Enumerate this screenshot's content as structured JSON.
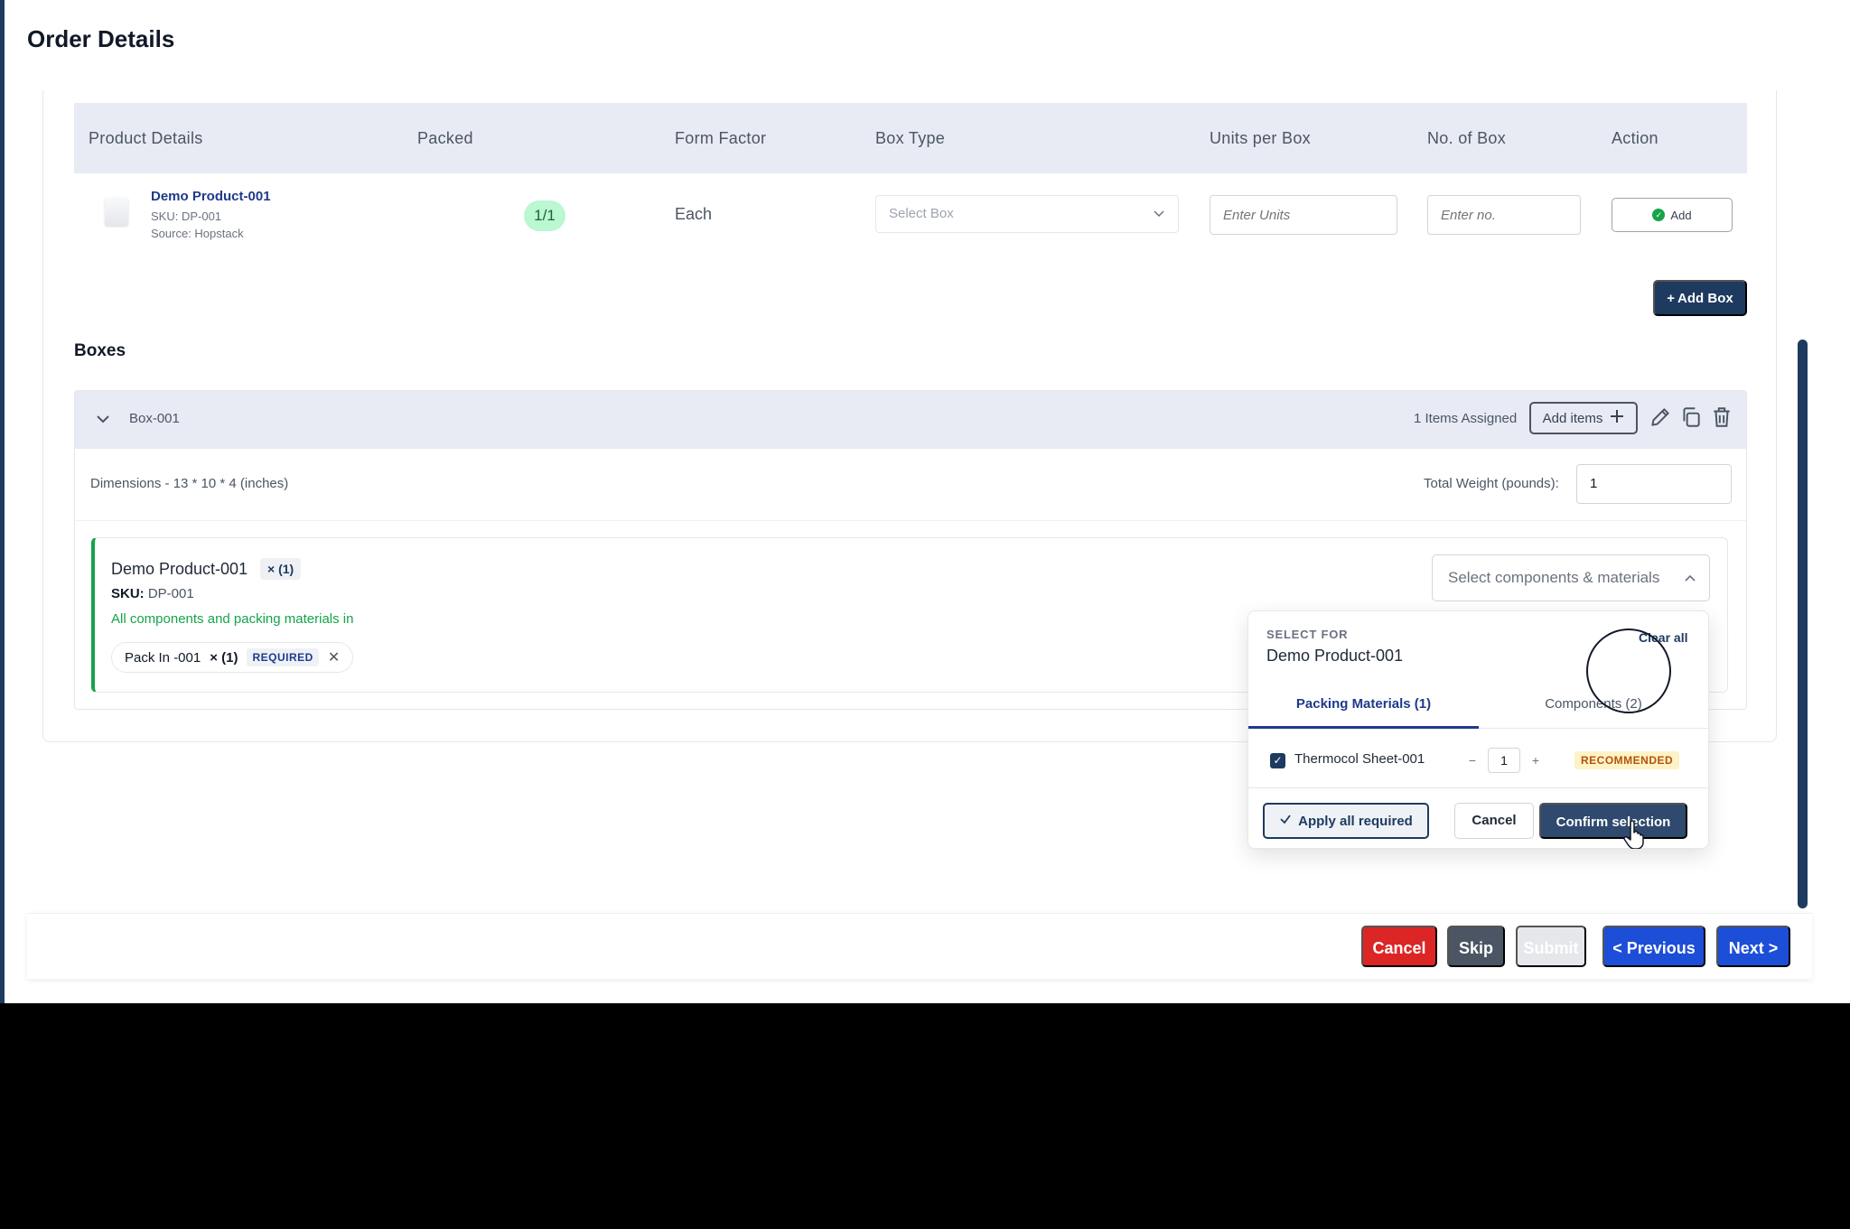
{
  "page": {
    "title": "Order Details"
  },
  "table": {
    "headers": [
      "Product Details",
      "Packed",
      "Form Factor",
      "Box Type",
      "Units per Box",
      "No. of Box",
      "Action"
    ],
    "row": {
      "name": "Demo Product-001",
      "sku": "SKU: DP-001",
      "source": "Source: Hopstack",
      "packed": "1/1",
      "form_factor": "Each",
      "box_placeholder": "Select Box",
      "units_placeholder": "Enter Units",
      "no_placeholder": "Enter no.",
      "action_label": "Add"
    },
    "add_box_label": "Add Box"
  },
  "boxes": {
    "title": "Boxes",
    "box": {
      "name": "Box-001",
      "items_assigned": "1 Items Assigned",
      "add_items_label": "Add items",
      "dimensions": "Dimensions - 13 * 10 * 4 (inches)",
      "weight_label": "Total Weight (pounds):",
      "weight_value": "1",
      "item": {
        "name": "Demo Product-001",
        "qty": "× (1)",
        "sku_label": "SKU:",
        "sku_value": "DP-001",
        "status": "All components and packing materials in",
        "chip_label": "Pack In -001",
        "chip_qty": "× (1)",
        "chip_badge": "REQUIRED",
        "select_label": "Select components & materials"
      }
    }
  },
  "popover": {
    "label": "SELECT FOR",
    "product": "Demo Product-001",
    "clear_all": "Clear all",
    "tabs": [
      "Packing Materials (1)",
      "Components (2)"
    ],
    "material": {
      "name": "Thermocol Sheet-001",
      "qty": "1",
      "badge": "RECOMMENDED"
    },
    "apply_label": "Apply all required",
    "cancel_label": "Cancel",
    "confirm_label": "Confirm selection"
  },
  "footer": {
    "cancel": "Cancel",
    "skip": "Skip",
    "submit": "Submit",
    "previous": "< Previous",
    "next": "Next >"
  },
  "colors": {
    "primary_dark": "#1e3a5f",
    "danger": "#dc2626",
    "blue": "#1d4ed8",
    "success": "#16a34a"
  },
  "icons": [
    "check-circle-icon",
    "plus-icon",
    "chevron-down-icon",
    "chevron-up-icon",
    "pencil-icon",
    "copy-icon",
    "trash-icon",
    "close-icon",
    "checkbox-icon",
    "hand-pointer-icon"
  ]
}
